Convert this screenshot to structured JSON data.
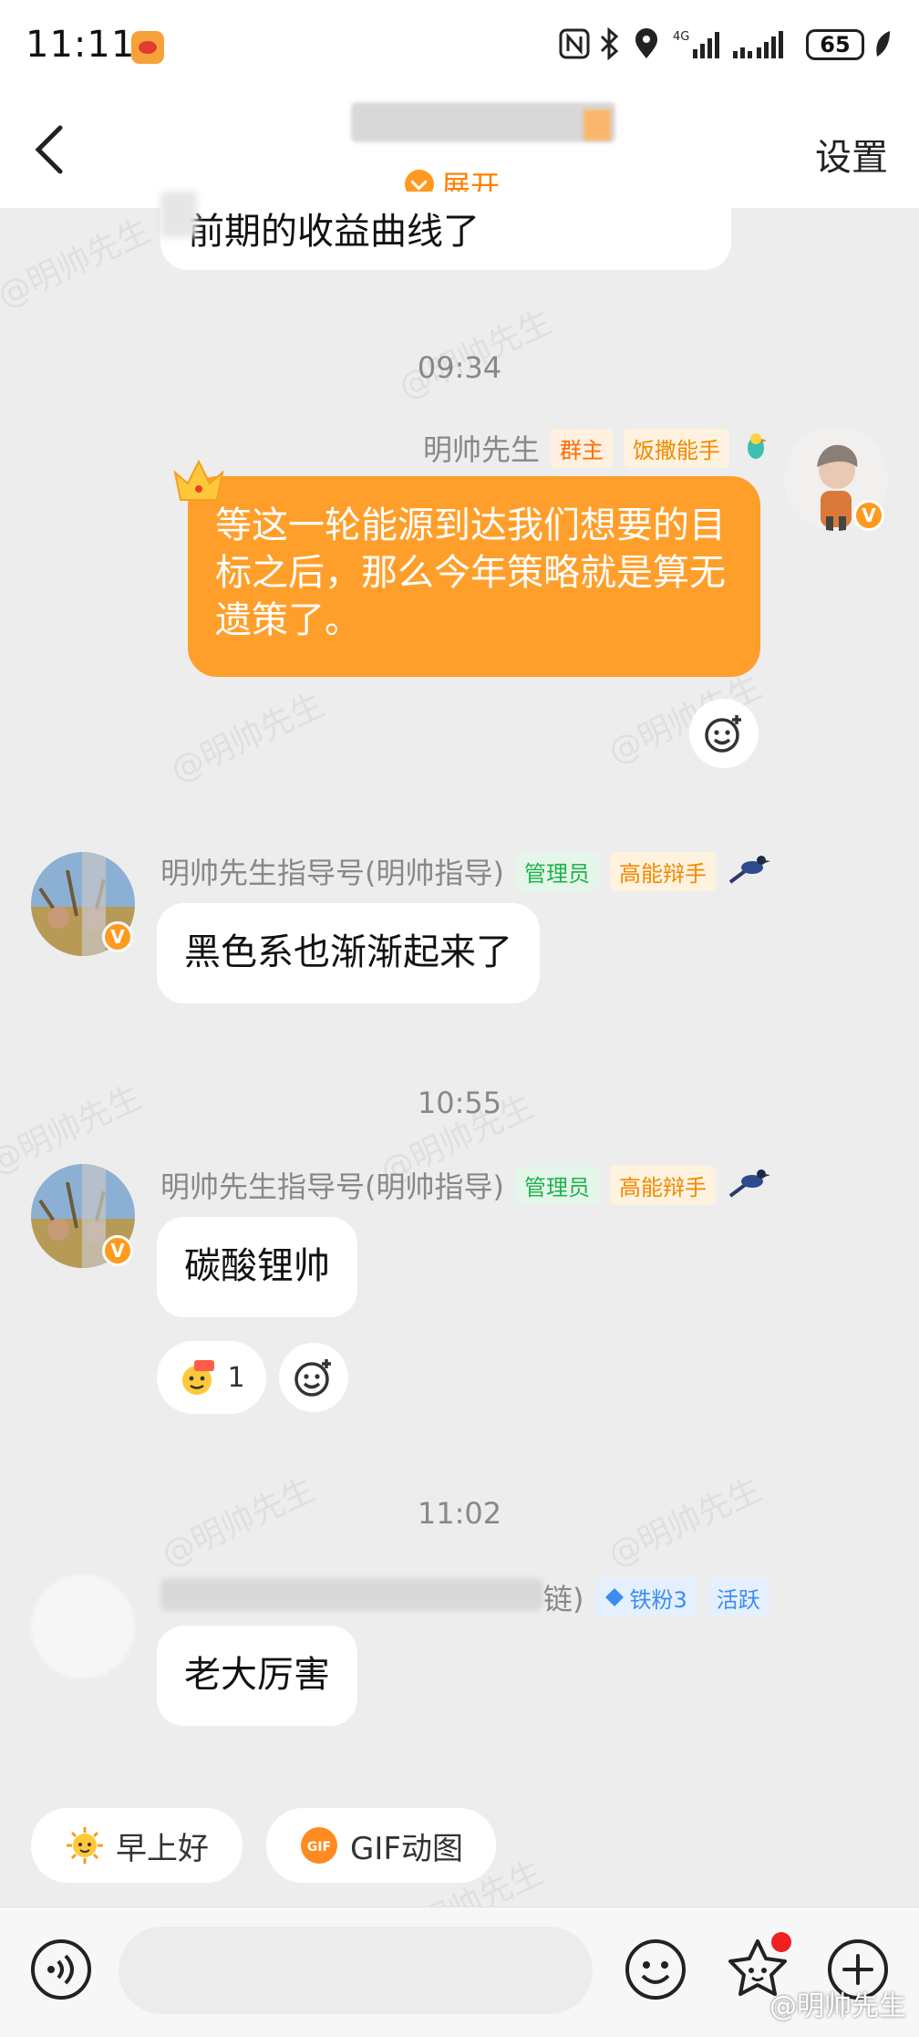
{
  "status_bar": {
    "time": "11:11",
    "battery": "65"
  },
  "header": {
    "expand_label": "展开",
    "settings_label": "设置"
  },
  "messages": {
    "prev_tail": "前期的收益曲线了",
    "time_1": "09:34",
    "owner": {
      "name": "明帅先生",
      "tag_1": "群主",
      "tag_2": "饭撒能手",
      "text": "等这一轮能源到达我们想要的目标之后，那么今年策略就是算无遗策了。"
    },
    "time_2": "10:55",
    "m1": {
      "name": "明帅先生指导号(明帅指导)",
      "tag_1": "管理员",
      "tag_2": "高能辩手",
      "text": "黑色系也渐渐起来了"
    },
    "m2": {
      "name": "明帅先生指导号(明帅指导)",
      "tag_1": "管理员",
      "tag_2": "高能辩手",
      "text": "碳酸锂帅",
      "reaction_count": "1"
    },
    "time_3": "11:02",
    "m3": {
      "name_tail": "链)",
      "tag_1": "铁粉3",
      "tag_2": "活跃",
      "text": "老大厉害"
    }
  },
  "quick_replies": [
    {
      "label": "早上好",
      "icon": "sun-face-icon"
    },
    {
      "label": "GIF动图",
      "icon": "gif-icon"
    }
  ],
  "watermark": "@明帅先生",
  "colors": {
    "accent": "#ff9f2b",
    "header_bg": "#ffffff",
    "chat_bg": "#ededed"
  }
}
